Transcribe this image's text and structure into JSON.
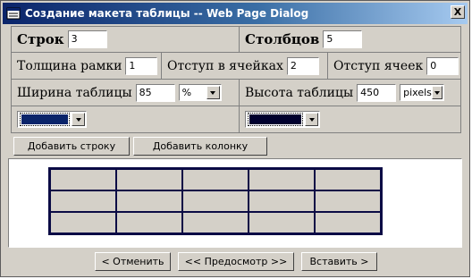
{
  "window": {
    "title": "Создание макета таблицы -- Web Page Dialog",
    "close_label": "X"
  },
  "form": {
    "rows_label": "Строк",
    "rows_value": "3",
    "cols_label": "Столбцов",
    "cols_value": "5",
    "border_label": "Толщина рамки",
    "border_value": "1",
    "padding_label": "Отступ в ячейках",
    "padding_value": "2",
    "spacing_label": "Отступ ячеек",
    "spacing_value": "0",
    "width_label": "Ширина таблицы",
    "width_value": "85",
    "width_unit": "%",
    "height_label": "Высота таблицы",
    "height_value": "450",
    "height_unit": "pixels",
    "color1": "#0a246a",
    "color2": "#00002e"
  },
  "tabs": {
    "add_row": "Добавить строку",
    "add_col": "Добавить колонку"
  },
  "preview": {
    "rows": 3,
    "cols": 5,
    "cell_color": "#d4d0c8",
    "border_color": "#0b0b45"
  },
  "buttons": {
    "cancel": "< Отменить",
    "preview": "<< Предосмотр >>",
    "insert": "Вставить >"
  }
}
